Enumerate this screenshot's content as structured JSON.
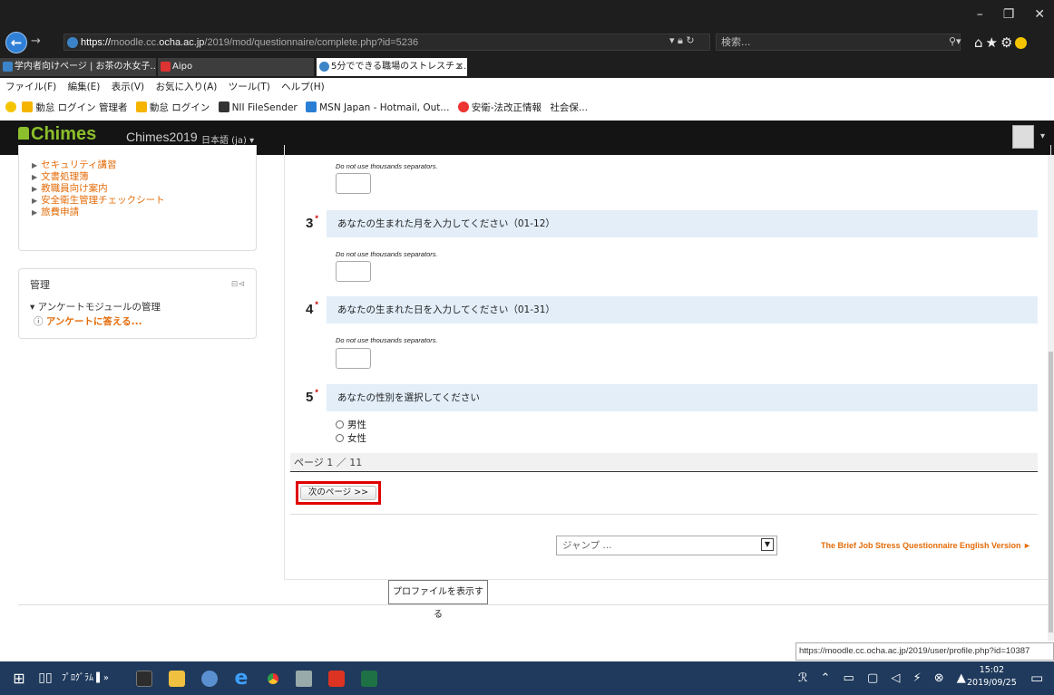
{
  "browser": {
    "url_prefix": "https://",
    "url_host": "moodle.cc.",
    "url_host_bold": "ocha.ac.jp",
    "url_path": "/2019/mod/questionnaire/complete.php?id=5236",
    "search_placeholder": "検索...",
    "tabs": [
      {
        "label": "学内者向けページ | お茶の水女子...",
        "color": "#3b84c8"
      },
      {
        "label": "Aipo",
        "color": "#d33"
      },
      {
        "label": "5分でできる職場のストレスチェ...",
        "color": "#3b84c8"
      }
    ],
    "tab_close": "✕",
    "menu": [
      "ファイル(F)",
      "編集(E)",
      "表示(V)",
      "お気に入り(A)",
      "ツール(T)",
      "ヘルプ(H)"
    ],
    "favorites": [
      {
        "label": "動怠 ログイン 管理者",
        "color": "#f5b400"
      },
      {
        "label": "動怠 ログイン",
        "color": "#f5b400"
      },
      {
        "label": "NII FileSender",
        "color": "#333"
      },
      {
        "label": "MSN Japan - Hotmail, Out...",
        "color": "#2a7fd4"
      },
      {
        "label": "安衛-法改正情報",
        "color": "#e33"
      },
      {
        "label": "社会保...",
        "color": "#fff"
      }
    ],
    "status_url": "https://moodle.cc.ocha.ac.jp/2019/user/profile.php?id=10387"
  },
  "moodle": {
    "brand": "Chimes",
    "site_name": "Chimes2019",
    "language": "日本語 (ja) ▾",
    "nav_block_items": [
      "セキュリティ講習",
      "文書処理簿",
      "教職員向け案内",
      "安全衛生管理チェックシート",
      "旅費申請"
    ],
    "admin_block": {
      "title": "管理",
      "tree_label": "アンケートモジュールの管理",
      "leaf_label": "アンケートに答える..."
    }
  },
  "questionnaire": {
    "separator_note": "Do not use thousands separators.",
    "questions": [
      {
        "number": "3",
        "required": "*",
        "text": "あなたの生まれた月を入力してください（01-12）"
      },
      {
        "number": "4",
        "required": "*",
        "text": "あなたの生まれた日を入力してください（01-31）"
      },
      {
        "number": "5",
        "required": "*",
        "text": "あなたの性別を選択してください"
      }
    ],
    "gender_options": [
      "男性",
      "女性"
    ],
    "page_indicator": "ページ 1 ／ 11",
    "next_button": "次のページ >>",
    "jump_placeholder": "ジャンプ ...",
    "english_link": "The Brief Job Stress Questionnaire English Version ►",
    "profile_tooltip": "プロファイルを表示する"
  },
  "taskbar": {
    "programs_label": "ﾌﾟﾛｸﾞﾗﾑ",
    "time": "15:02",
    "date": "2019/09/25"
  }
}
